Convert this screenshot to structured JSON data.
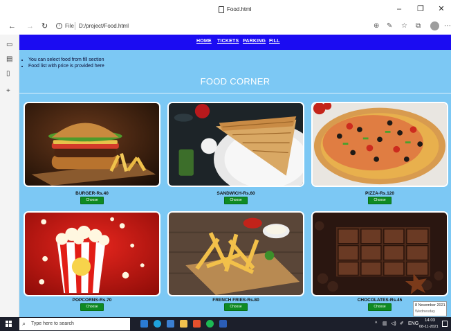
{
  "window": {
    "tab_title": "Food.html",
    "controls": {
      "minimize": "–",
      "restore": "❐",
      "close": "✕"
    }
  },
  "browser": {
    "back_icon": "←",
    "forward_icon": "→",
    "refresh_icon": "↻",
    "file_label": "File",
    "url": "D:/project/Food.html",
    "toolbar_icons": [
      "zoom-icon",
      "read-aloud-icon",
      "favorite-icon",
      "collections-icon",
      "profile-avatar",
      "more-icon"
    ]
  },
  "sidebar_icons": [
    "tab-actions-icon",
    "history-icon",
    "page-icon",
    "add-icon"
  ],
  "site": {
    "nav": [
      {
        "label": "HOME"
      },
      {
        "label": "TICKETS"
      },
      {
        "label": "PARKING"
      },
      {
        "label": "FILL"
      }
    ],
    "notes": [
      "You can select food from fill section",
      "Food list with price is provided here"
    ],
    "heading": "FOOD CORNER",
    "choose_label": "Choose",
    "foods": [
      {
        "label": "BURGER-Rs.40"
      },
      {
        "label": "SANDWICH-Rs.60"
      },
      {
        "label": "PIZZA-Rs.120"
      },
      {
        "label": "POPCORNS-Rs.70"
      },
      {
        "label": "FRENCH FRIES-Rs.80"
      },
      {
        "label": "CHOCOLATES-Rs.45"
      }
    ]
  },
  "taskbar": {
    "search_placeholder": "Type here to search",
    "apps": [
      "store-icon",
      "edge-icon",
      "task-view-icon",
      "file-explorer-icon",
      "office-icon",
      "spotify-icon",
      "word-icon"
    ],
    "tray_lang": "ENG",
    "time": "14:03",
    "date": "08-11-2021",
    "tooltip_date": "8 November 2021",
    "tooltip_day": "Wednesday"
  },
  "colors": {
    "nav_bg": "#1b0cf2",
    "page_bg": "#7cc8f4",
    "button": "#0f8a23",
    "taskbar": "#1c1f2b"
  }
}
